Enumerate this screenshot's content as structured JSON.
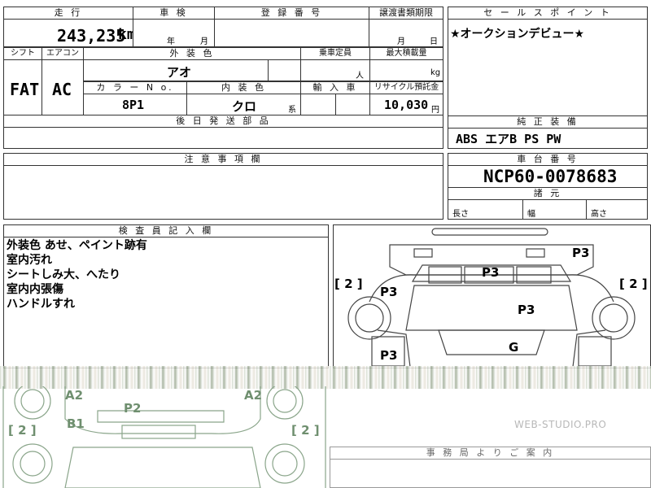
{
  "top": {
    "mileage_label": "走 行",
    "mileage_value": "243,235",
    "mileage_unit": "km",
    "inspection_label": "車 検",
    "inspection_year": "年",
    "inspection_month": "月",
    "registration_label": "登 録 番 号",
    "transfer_label": "譲渡書類期限",
    "transfer_month": "月",
    "transfer_day": "日"
  },
  "row2": {
    "shift_label": "シフト",
    "shift_value": "FAT",
    "ac_label": "エアコン",
    "ac_value": "AC",
    "exterior_label": "外 装 色",
    "exterior_value": "アオ",
    "capacity_label": "乗車定員",
    "capacity_unit": "人",
    "load_label": "最大積載量",
    "load_unit": "kg",
    "color_no_label": "カ ラ ー N o.",
    "color_no_value": "8P1",
    "interior_label": "内 装 色",
    "interior_value": "クロ",
    "interior_suffix": "系",
    "import_label": "輸 入 車",
    "recycle_label": "リサイクル預託金",
    "recycle_value": "10,030",
    "recycle_unit": "円"
  },
  "parts_label": "後 日 発 送 部 品",
  "sales": {
    "label": "セ ー ル ス ポ イ ン ト",
    "text": "★オークションデビュー★"
  },
  "equipment": {
    "label": "純 正 装 備",
    "value": "ABS エアB PS PW"
  },
  "notes_label": "注 意 事 項 欄",
  "chassis": {
    "label": "車 台 番 号",
    "value": "NCP60-0078683"
  },
  "specs": {
    "label": "諸 元",
    "length": "長さ",
    "width": "幅",
    "height": "高さ"
  },
  "inspector": {
    "label": "検 査 員 記 入 欄",
    "lines": [
      "外装色 あせ、ペイント跡有",
      "室内汚れ",
      "シートしみ大、へたり",
      "室内内張傷",
      "ハンドルすれ"
    ]
  },
  "diagram": {
    "marks": [
      "P3",
      "P3",
      "P3",
      "P3",
      "P3",
      "G",
      "A2",
      "A2",
      "P2",
      "B1"
    ],
    "tire_left_top": "[ 2 ]",
    "tire_right_top": "[ 2 ]",
    "tire_left_bottom": "[ 2 ]",
    "tire_right_bottom": "[ 2 ]"
  },
  "watermark": "WEB-STUDIO.PRO",
  "office_label": "事 務 局 よ り ご 案 内"
}
